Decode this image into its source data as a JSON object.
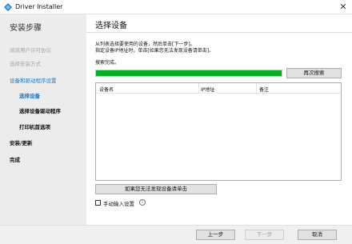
{
  "window": {
    "title": "Driver Installer",
    "close_glyph": "✕"
  },
  "sidebar": {
    "heading": "安装步骤",
    "items": [
      {
        "label": "阅读用户许可协议"
      },
      {
        "label": "选择安装方式"
      },
      {
        "label": "设备和驱动程序设置"
      },
      {
        "label": "选择设备"
      },
      {
        "label": "选择设备驱动程序"
      },
      {
        "label": "打印机首选项"
      },
      {
        "label": "安装/更新"
      },
      {
        "label": "完成"
      }
    ]
  },
  "main": {
    "title": "选择设备",
    "instruction_1": "从列表选择要使用的设备，然后单击[下一步]。",
    "instruction_2": "指定设备IP地址时，单击[如果您无法发现设备请单击]。",
    "status": "搜索完成。",
    "progress": 1.0,
    "rescan_label": "再次搜索",
    "table_headers": [
      "设备名",
      "IP地址",
      "备注"
    ],
    "not_found_label": "如果您无法发现设备请单击",
    "manual_label": "手动输入设置",
    "info_glyph": "i"
  },
  "footer": {
    "back_label": "上一步",
    "next_label": "下一步",
    "cancel_label": "取消"
  }
}
